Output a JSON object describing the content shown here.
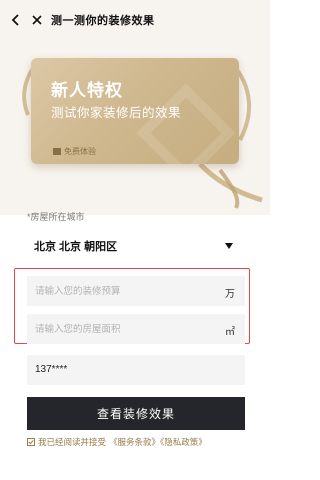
{
  "header": {
    "title": "测一测你的装修效果"
  },
  "card": {
    "title": "新人特权",
    "subtitle": "测试你家装修后的效果",
    "trial_label": "免费体验"
  },
  "location": {
    "label": "*房屋所在城市",
    "value": "北京 北京 朝阳区"
  },
  "budget": {
    "placeholder": "请输入您的装修预算",
    "unit": "万"
  },
  "area": {
    "placeholder": "请输入您的房屋面积",
    "unit": "㎡"
  },
  "phone": {
    "value": "137****"
  },
  "submit_label": "查看装修效果",
  "agreement": {
    "prefix": "我已经阅读并接受",
    "links": "《服务条款》《隐私政策》"
  },
  "colors": {
    "card_gold": "#cfb88f",
    "highlight_red": "#e8454a",
    "button_dark": "#24262b",
    "link_gold": "#9a7a48"
  }
}
